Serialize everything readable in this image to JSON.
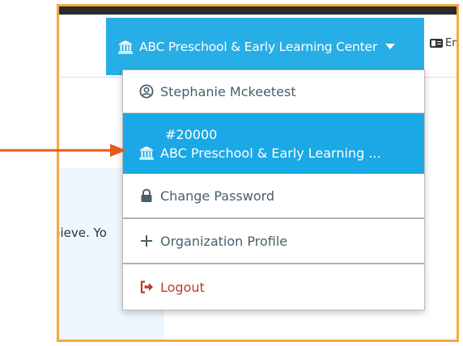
{
  "header": {
    "organization_button_label": "ABC Preschool & Early Learning Center",
    "environment_label": "En"
  },
  "background": {
    "body_text": "hieve. Yo"
  },
  "menu": {
    "user_name": "Stephanie Mckeetest",
    "org_id": "#20000",
    "org_name": "ABC Preschool & Early Learning ...",
    "change_password": "Change Password",
    "organization_profile": "Organization Profile",
    "logout": "Logout"
  },
  "colors": {
    "accent_blue": "#28aee6",
    "selected_blue": "#1aa8e6",
    "logout_red": "#c0392b",
    "frame_orange": "#f5a840",
    "arrow_orange": "#e8591a"
  },
  "icons": {
    "bank": "bank-icon",
    "user": "user-circle-icon",
    "lock": "lock-icon",
    "plus": "plus-icon",
    "logout": "sign-out-icon",
    "caret": "caret-down-icon",
    "id_card": "id-card-icon"
  }
}
